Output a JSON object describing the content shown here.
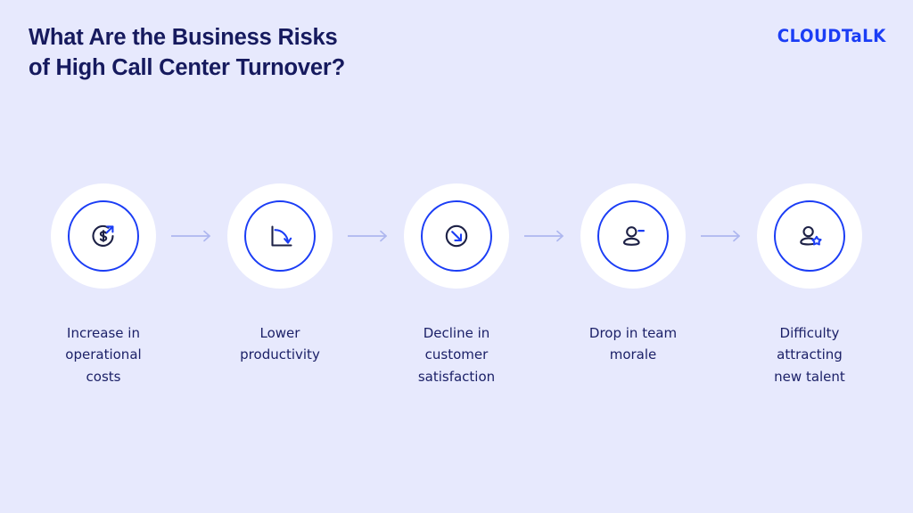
{
  "header": {
    "title": "What Are the Business Risks\nof High Call Center Turnover?",
    "logo_text": "CLOUDTaLK"
  },
  "colors": {
    "background": "#e7e9fd",
    "navy": "#161a5e",
    "blue": "#1b3df5",
    "arrow": "#aeb7ef",
    "disc": "#ffffff"
  },
  "flow": {
    "steps": [
      {
        "label": "Increase in\noperational\ncosts",
        "icon": "dollar-growth-icon"
      },
      {
        "label": "Lower\nproductivity",
        "icon": "declining-chart-icon"
      },
      {
        "label": "Decline in\ncustomer\nsatisfaction",
        "icon": "arrow-down-right-circle-icon"
      },
      {
        "label": "Drop in team\nmorale",
        "icon": "user-minus-icon"
      },
      {
        "label": "Difficulty\nattracting\nnew talent",
        "icon": "user-star-icon"
      }
    ],
    "connector_icon": "arrow-right-icon"
  }
}
